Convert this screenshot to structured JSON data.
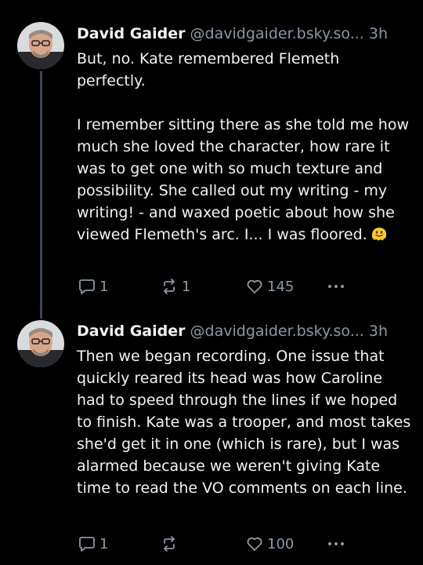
{
  "posts": [
    {
      "author_name": "David Gaider",
      "handle": "@davidgaider.bsky.so...",
      "time": "3h",
      "text": "But, no. Kate remembered Flemeth perfectly.\n\nI remember sitting there as she told me how much she loved the character, how rare it was to get one with so much texture and possibility. She called out my writing - my writing! - and waxed poetic about how she viewed Flemeth's arc. I... I was floored.",
      "trailing_emoji": "melting-face-emoji",
      "replies": "1",
      "reposts": "1",
      "likes": "145"
    },
    {
      "author_name": "David Gaider",
      "handle": "@davidgaider.bsky.so...",
      "time": "3h",
      "text": "Then we began recording. One issue that quickly reared its head was how Caroline had to speed through the lines if we hoped to finish. Kate was a trooper, and most takes she'd get it in one (which is rare), but I was alarmed because we weren't giving Kate time to read the VO comments on each line.",
      "replies": "1",
      "reposts": "",
      "likes": "100"
    }
  ],
  "colors": {
    "background": "#000000",
    "text": "#f1f3f5",
    "muted": "#8b98a9",
    "thread_line": "#3d4654"
  },
  "icons": [
    "reply-icon",
    "repost-icon",
    "like-icon",
    "more-icon"
  ]
}
